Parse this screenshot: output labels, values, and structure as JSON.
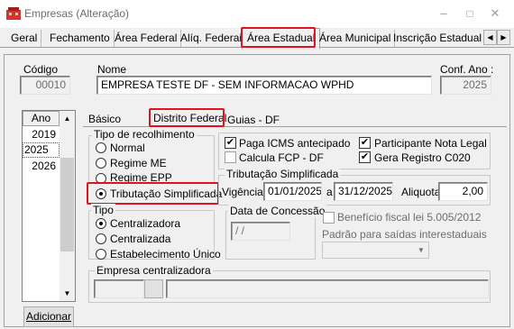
{
  "window": {
    "title": "Empresas (Alteração)",
    "minimize": "–",
    "maximize": "□",
    "close": "✕"
  },
  "tabs": [
    {
      "label": "Geral"
    },
    {
      "label": "Fechamento"
    },
    {
      "label": "Área Federal"
    },
    {
      "label": "Alíq. Federais"
    },
    {
      "label": "Área Estadual"
    },
    {
      "label": "Área Municipal"
    },
    {
      "label": "Inscrição Estadual S"
    }
  ],
  "tab_scroll": {
    "left": "◀",
    "right": "▶"
  },
  "header": {
    "codigo_label": "Código",
    "codigo_value": "00010",
    "nome_label": "Nome",
    "nome_value": "EMPRESA TESTE DF - SEM INFORMACAO WPHD",
    "conf_ano_label": "Conf. Ano :",
    "conf_ano_value": "2025"
  },
  "years": {
    "header": "Ano",
    "items": [
      "2019",
      "2025",
      "2026"
    ],
    "scroll_up": "▲",
    "scroll_down": "▼",
    "add_button": "Adicionar"
  },
  "subtabs": [
    {
      "label": "Básico"
    },
    {
      "label": "Distrito Federal"
    },
    {
      "label": "Guias - DF"
    }
  ],
  "tipo_recolhimento": {
    "title": "Tipo de recolhimento",
    "options": [
      "Normal",
      "Regime ME",
      "Regime EPP",
      "Tributação Simplificada"
    ],
    "selected": "Tributação Simplificada"
  },
  "checks": {
    "paga_icms": "Paga ICMS antecipado",
    "calcula_fcp": "Calcula FCP - DF",
    "participante": "Participante Nota Legal",
    "gera_registro": "Gera Registro C020",
    "check_mark": "✔"
  },
  "trib_simplificada": {
    "title": "Tributação Simplificada",
    "vigencia_label": "Vigência",
    "vigencia_start": "01/01/2025",
    "a_label": "a",
    "vigencia_end": "31/12/2025",
    "aliquota_label": "Aliquota",
    "aliquota_value": "2,00"
  },
  "tipo": {
    "title": "Tipo",
    "options": [
      "Centralizadora",
      "Centralizada",
      "Estabelecimento Único"
    ],
    "selected": "Centralizadora"
  },
  "concessao": {
    "label": "Data de Concessão",
    "value": "/ /"
  },
  "beneficio": {
    "label": "Benefício fiscal lei 5.005/2012"
  },
  "padrao": {
    "label": "Padrão para saídas interestaduais",
    "value": "",
    "arrow": "▼"
  },
  "empresa_central": {
    "title": "Empresa centralizadora",
    "code": "",
    "name": ""
  }
}
